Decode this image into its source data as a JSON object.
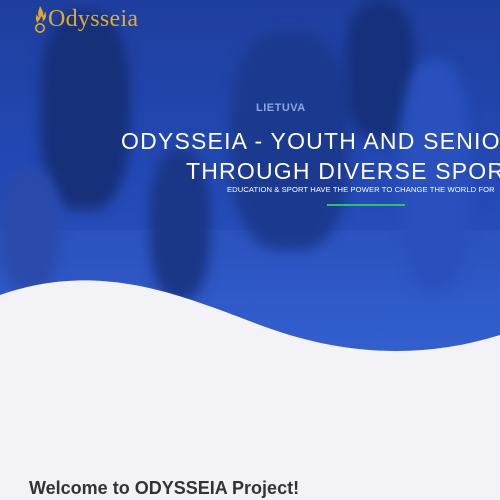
{
  "brand": {
    "name": "Odysseia",
    "logo_icon": "flame-icon",
    "accent_color": "#e2aa2c"
  },
  "hero": {
    "title_line1": "ODYSSEIA - YOUTH AND SENIOR IN",
    "title_line2": "THROUGH DIVERSE SPORT E",
    "tagline": "EDUCATION & SPORT HAVE THE POWER TO CHANGE THE WORLD FOR",
    "photo_jersey_text": "LIETUVA",
    "divider_color": "#2fbf71"
  },
  "main": {
    "heading": "Welcome to ODYSSEIA Project!"
  }
}
